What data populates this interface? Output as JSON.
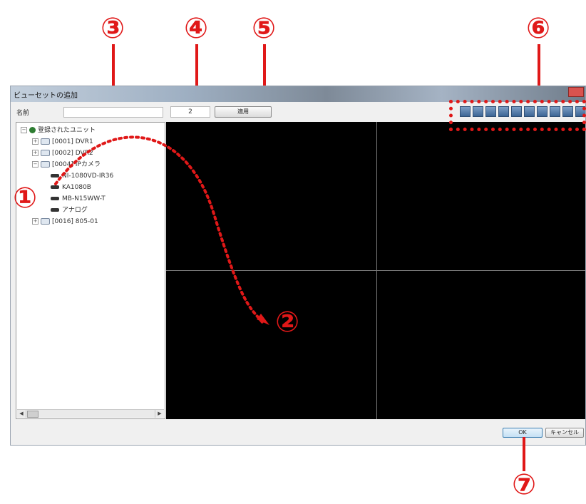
{
  "window": {
    "title": "ビューセットの追加"
  },
  "toolbar": {
    "name_label": "名前",
    "name_value": "",
    "count_value": "2",
    "apply_label": "適用"
  },
  "tree": {
    "root_label": "登録されたユニット",
    "nodes": [
      {
        "label": "[0001] DVR1"
      },
      {
        "label": "[0002] DVR2"
      },
      {
        "label": "[0004] IPカメラ"
      },
      {
        "label": "NI-1080VD-IR36"
      },
      {
        "label": "KA1080B"
      },
      {
        "label": "MB-N15WW-T"
      },
      {
        "label": "アナログ"
      },
      {
        "label": "[0016] 805-01"
      }
    ]
  },
  "footer": {
    "ok_label": "OK",
    "cancel_label": "キャンセル"
  },
  "annotations": {
    "callouts": [
      "③",
      "④",
      "⑤",
      "⑥",
      "①",
      "②",
      "⑦"
    ]
  },
  "colors": {
    "callout": "#e01818",
    "video_bg": "#000000",
    "dialog_bg": "#f0f0f0"
  }
}
